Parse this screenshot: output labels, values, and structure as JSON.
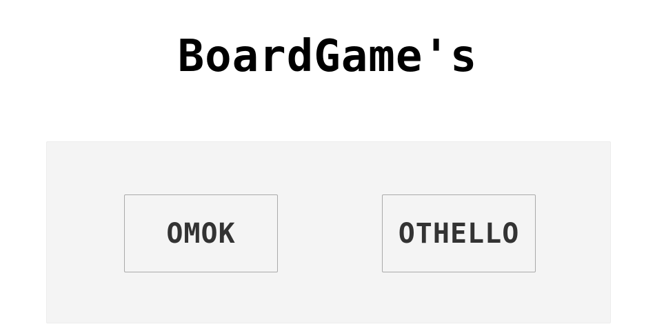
{
  "header": {
    "title": "BoardGame's"
  },
  "menu": {
    "games": [
      {
        "label": "OMOK"
      },
      {
        "label": "OTHELLO"
      }
    ]
  },
  "colors": {
    "background": "#ffffff",
    "panel": "#f4f4f4",
    "button_border": "#a9a9a9",
    "button_text": "#333333",
    "title_text": "#000000"
  }
}
